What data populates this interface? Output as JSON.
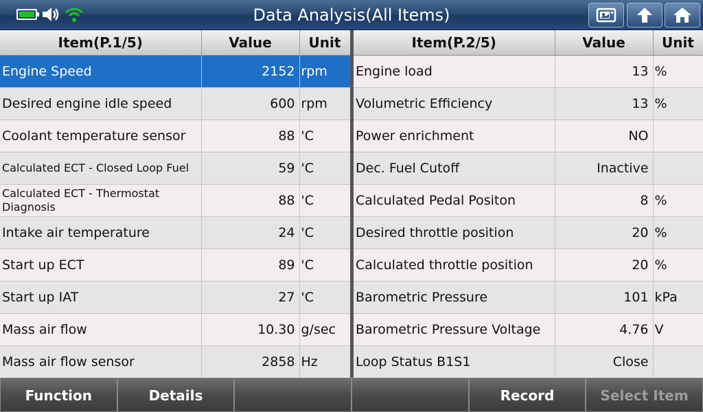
{
  "title": "Data Analysis(All Items)",
  "status_icons": [
    "battery-icon",
    "speaker-icon",
    "wifi-icon"
  ],
  "title_buttons": [
    "screenshot-icon",
    "back-up-icon",
    "home-icon"
  ],
  "left_table": {
    "headers": {
      "item": "Item(P.1/5)",
      "value": "Value",
      "unit": "Unit"
    },
    "rows": [
      {
        "item": "Engine Speed",
        "value": "2152",
        "unit": "rpm"
      },
      {
        "item": "Desired engine idle speed",
        "value": "600",
        "unit": "rpm"
      },
      {
        "item": "Coolant temperature sensor",
        "value": "88",
        "unit": "'C"
      },
      {
        "item": "Calculated ECT - Closed Loop Fuel",
        "value": "59",
        "unit": "'C"
      },
      {
        "item": "Calculated ECT - Thermostat Diagnosis",
        "value": "88",
        "unit": "'C"
      },
      {
        "item": "Intake air temperature",
        "value": "24",
        "unit": "'C"
      },
      {
        "item": "Start up ECT",
        "value": "89",
        "unit": "'C"
      },
      {
        "item": "Start up IAT",
        "value": "27",
        "unit": "'C"
      },
      {
        "item": "Mass air flow",
        "value": "10.30",
        "unit": "g/sec"
      },
      {
        "item": "Mass air flow sensor",
        "value": "2858",
        "unit": "Hz"
      }
    ]
  },
  "right_table": {
    "headers": {
      "item": "Item(P.2/5)",
      "value": "Value",
      "unit": "Unit"
    },
    "rows": [
      {
        "item": "Engine load",
        "value": "13",
        "unit": "%"
      },
      {
        "item": "Volumetric Efficiency",
        "value": "13",
        "unit": "%"
      },
      {
        "item": "Power enrichment",
        "value": "NO",
        "unit": ""
      },
      {
        "item": "Dec. Fuel Cutoff",
        "value": "Inactive",
        "unit": ""
      },
      {
        "item": "Calculated Pedal Positon",
        "value": "8",
        "unit": "%"
      },
      {
        "item": "Desired throttle position",
        "value": "20",
        "unit": "%"
      },
      {
        "item": "Calculated throttle position",
        "value": "20",
        "unit": "%"
      },
      {
        "item": "Barometric Pressure",
        "value": "101",
        "unit": "kPa"
      },
      {
        "item": "Barometric Pressure Voltage",
        "value": "4.76",
        "unit": "V"
      },
      {
        "item": "Loop Status B1S1",
        "value": "Close",
        "unit": ""
      }
    ]
  },
  "bottom_bar": {
    "function": "Function",
    "details": "Details",
    "empty1": "",
    "empty2": "",
    "record": "Record",
    "select_item": "Select Item"
  },
  "colors": {
    "selected_row": "#1e6fc6",
    "title_bar": "#2a4a72",
    "battery": "#21c021",
    "wifi": "#21c021"
  }
}
